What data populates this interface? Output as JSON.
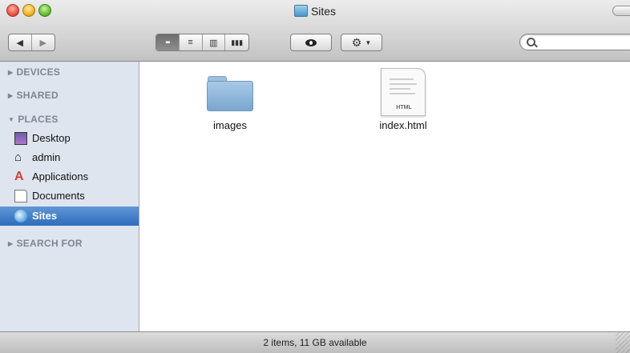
{
  "window": {
    "title": "Sites",
    "status": "2 items, 11 GB available"
  },
  "toolbar": {
    "back_icon": "back-arrow-icon",
    "forward_icon": "forward-arrow-icon",
    "view_buttons": [
      "icon-view",
      "list-view",
      "column-view",
      "coverflow-view"
    ],
    "selected_view": "icon-view",
    "search_placeholder": ""
  },
  "sidebar": {
    "sections": {
      "devices": "DEVICES",
      "shared": "SHARED",
      "places": "PLACES",
      "search_for": "SEARCH FOR"
    },
    "places_items": [
      {
        "label": "Desktop",
        "icon": "desktop-icon"
      },
      {
        "label": "admin",
        "icon": "home-icon"
      },
      {
        "label": "Applications",
        "icon": "applications-icon"
      },
      {
        "label": "Documents",
        "icon": "documents-icon"
      },
      {
        "label": "Sites",
        "icon": "sites-icon",
        "selected": true
      }
    ]
  },
  "files": [
    {
      "name": "images",
      "type": "folder"
    },
    {
      "name": "index.html",
      "type": "html",
      "badge": "HTML"
    }
  ],
  "colors": {
    "selection": "#3e7cc6",
    "sidebar_bg": "#dfe5ee",
    "folder": "#8fb6da"
  }
}
